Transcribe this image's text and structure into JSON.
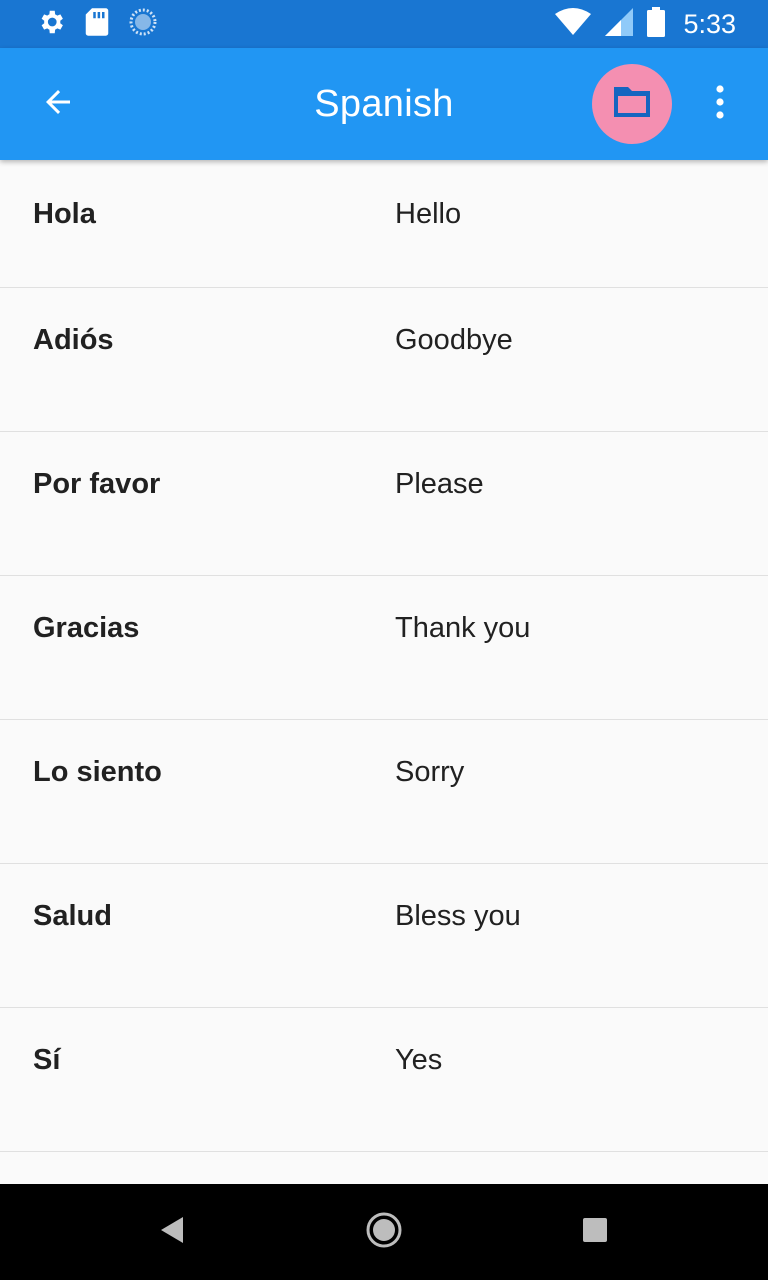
{
  "status_bar": {
    "icons_left": [
      "settings-icon",
      "sd-card-icon",
      "sync-progress-icon"
    ],
    "icons_right": [
      "wifi-icon",
      "cell-signal-icon",
      "battery-icon"
    ],
    "time": "5:33"
  },
  "app_bar": {
    "title": "Spanish",
    "back_icon": "arrow-back-icon",
    "folder_icon": "folder-icon",
    "more_icon": "more-vert-icon"
  },
  "colors": {
    "status_bar": "#1976d2",
    "app_bar": "#2196f3",
    "folder_button": "#f48fb1",
    "background": "#fafafa"
  },
  "phrases": [
    {
      "spanish": "Hola",
      "english": "Hello"
    },
    {
      "spanish": "Adiós",
      "english": "Goodbye"
    },
    {
      "spanish": "Por favor",
      "english": "Please"
    },
    {
      "spanish": "Gracias",
      "english": "Thank you"
    },
    {
      "spanish": "Lo siento",
      "english": "Sorry"
    },
    {
      "spanish": "Salud",
      "english": "Bless you"
    },
    {
      "spanish": "Sí",
      "english": "Yes"
    }
  ],
  "nav_bar": {
    "buttons": [
      "back-triangle-icon",
      "home-circle-icon",
      "recents-square-icon"
    ]
  }
}
